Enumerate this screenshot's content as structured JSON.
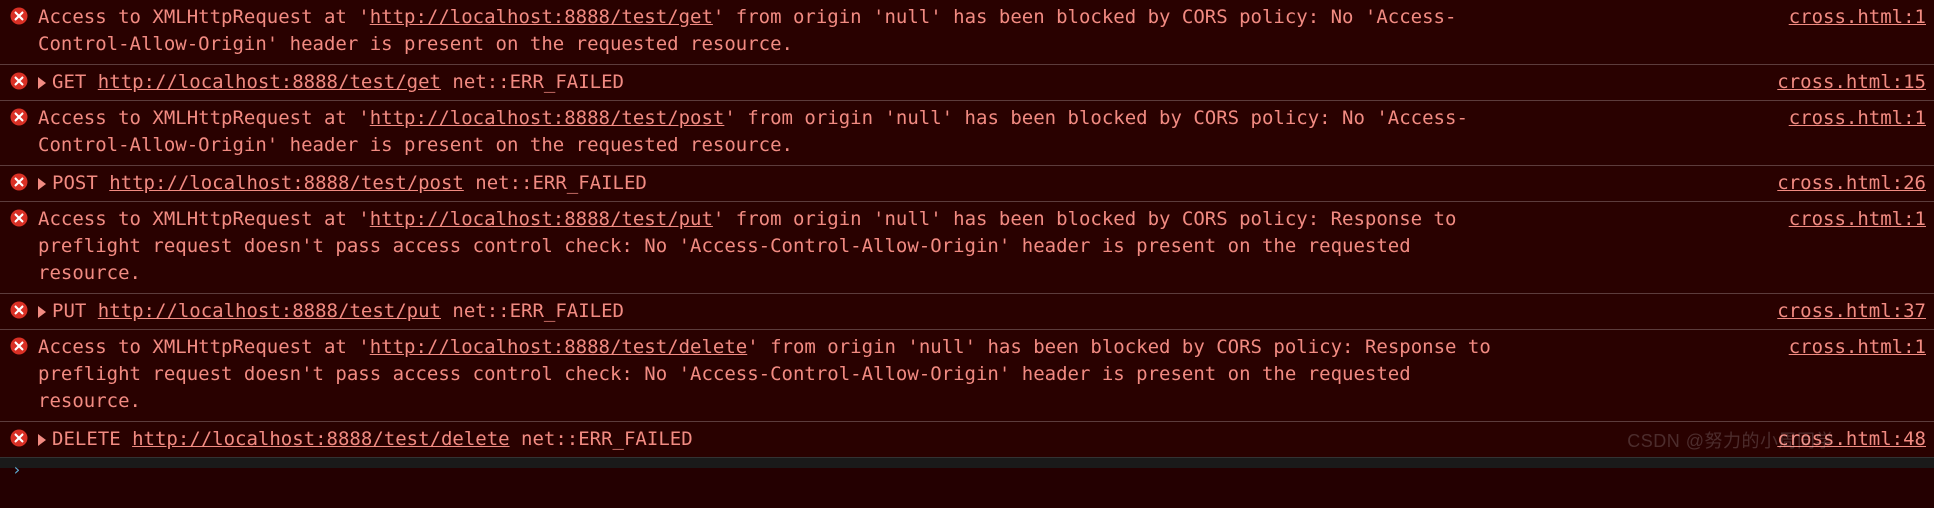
{
  "entries": [
    {
      "kind": "cors",
      "pre": "Access to XMLHttpRequest at '",
      "url": "http://localhost:8888/test/get",
      "post": "' from origin 'null' has been blocked by CORS policy: No 'Access-Control-Allow-Origin' header is present on the requested resource.",
      "source": "cross.html:1"
    },
    {
      "kind": "req",
      "method": "GET",
      "url": "http://localhost:8888/test/get",
      "tail": "net::ERR_FAILED",
      "source": "cross.html:15"
    },
    {
      "kind": "cors",
      "pre": "Access to XMLHttpRequest at '",
      "url": "http://localhost:8888/test/post",
      "post": "' from origin 'null' has been blocked by CORS policy: No 'Access-Control-Allow-Origin' header is present on the requested resource.",
      "source": "cross.html:1"
    },
    {
      "kind": "req",
      "method": "POST",
      "url": "http://localhost:8888/test/post",
      "tail": "net::ERR_FAILED",
      "source": "cross.html:26"
    },
    {
      "kind": "cors",
      "pre": "Access to XMLHttpRequest at '",
      "url": "http://localhost:8888/test/put",
      "post": "' from origin 'null' has been blocked by CORS policy: Response to preflight request doesn't pass access control check: No 'Access-Control-Allow-Origin' header is present on the requested resource.",
      "source": "cross.html:1"
    },
    {
      "kind": "req",
      "method": "PUT",
      "url": "http://localhost:8888/test/put",
      "tail": "net::ERR_FAILED",
      "source": "cross.html:37"
    },
    {
      "kind": "cors",
      "pre": "Access to XMLHttpRequest at '",
      "url": "http://localhost:8888/test/delete",
      "post": "' from origin 'null' has been blocked by CORS policy: Response to preflight request doesn't pass access control check: No 'Access-Control-Allow-Origin' header is present on the requested resource.",
      "source": "cross.html:1"
    },
    {
      "kind": "req",
      "method": "DELETE",
      "url": "http://localhost:8888/test/delete",
      "tail": "net::ERR_FAILED",
      "source": "cross.html:48"
    }
  ],
  "watermark": "CSDN @努力的小周同学"
}
